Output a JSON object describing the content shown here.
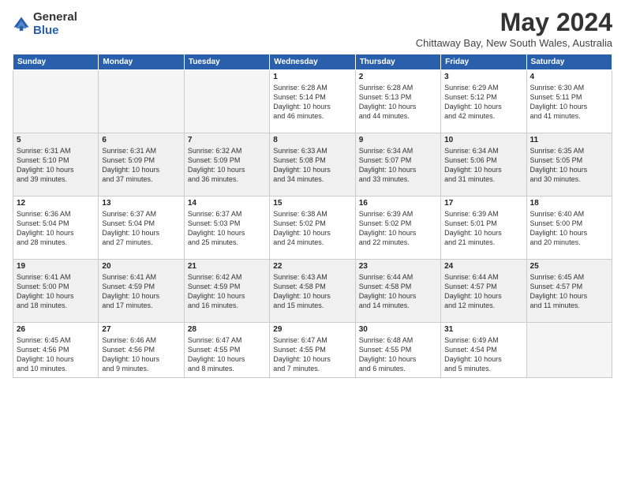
{
  "header": {
    "logo_general": "General",
    "logo_blue": "Blue",
    "title": "May 2024",
    "subtitle": "Chittaway Bay, New South Wales, Australia"
  },
  "weekdays": [
    "Sunday",
    "Monday",
    "Tuesday",
    "Wednesday",
    "Thursday",
    "Friday",
    "Saturday"
  ],
  "weeks": [
    {
      "shaded": false,
      "days": [
        {
          "num": "",
          "info": ""
        },
        {
          "num": "",
          "info": ""
        },
        {
          "num": "",
          "info": ""
        },
        {
          "num": "1",
          "info": "Sunrise: 6:28 AM\nSunset: 5:14 PM\nDaylight: 10 hours\nand 46 minutes."
        },
        {
          "num": "2",
          "info": "Sunrise: 6:28 AM\nSunset: 5:13 PM\nDaylight: 10 hours\nand 44 minutes."
        },
        {
          "num": "3",
          "info": "Sunrise: 6:29 AM\nSunset: 5:12 PM\nDaylight: 10 hours\nand 42 minutes."
        },
        {
          "num": "4",
          "info": "Sunrise: 6:30 AM\nSunset: 5:11 PM\nDaylight: 10 hours\nand 41 minutes."
        }
      ]
    },
    {
      "shaded": true,
      "days": [
        {
          "num": "5",
          "info": "Sunrise: 6:31 AM\nSunset: 5:10 PM\nDaylight: 10 hours\nand 39 minutes."
        },
        {
          "num": "6",
          "info": "Sunrise: 6:31 AM\nSunset: 5:09 PM\nDaylight: 10 hours\nand 37 minutes."
        },
        {
          "num": "7",
          "info": "Sunrise: 6:32 AM\nSunset: 5:09 PM\nDaylight: 10 hours\nand 36 minutes."
        },
        {
          "num": "8",
          "info": "Sunrise: 6:33 AM\nSunset: 5:08 PM\nDaylight: 10 hours\nand 34 minutes."
        },
        {
          "num": "9",
          "info": "Sunrise: 6:34 AM\nSunset: 5:07 PM\nDaylight: 10 hours\nand 33 minutes."
        },
        {
          "num": "10",
          "info": "Sunrise: 6:34 AM\nSunset: 5:06 PM\nDaylight: 10 hours\nand 31 minutes."
        },
        {
          "num": "11",
          "info": "Sunrise: 6:35 AM\nSunset: 5:05 PM\nDaylight: 10 hours\nand 30 minutes."
        }
      ]
    },
    {
      "shaded": false,
      "days": [
        {
          "num": "12",
          "info": "Sunrise: 6:36 AM\nSunset: 5:04 PM\nDaylight: 10 hours\nand 28 minutes."
        },
        {
          "num": "13",
          "info": "Sunrise: 6:37 AM\nSunset: 5:04 PM\nDaylight: 10 hours\nand 27 minutes."
        },
        {
          "num": "14",
          "info": "Sunrise: 6:37 AM\nSunset: 5:03 PM\nDaylight: 10 hours\nand 25 minutes."
        },
        {
          "num": "15",
          "info": "Sunrise: 6:38 AM\nSunset: 5:02 PM\nDaylight: 10 hours\nand 24 minutes."
        },
        {
          "num": "16",
          "info": "Sunrise: 6:39 AM\nSunset: 5:02 PM\nDaylight: 10 hours\nand 22 minutes."
        },
        {
          "num": "17",
          "info": "Sunrise: 6:39 AM\nSunset: 5:01 PM\nDaylight: 10 hours\nand 21 minutes."
        },
        {
          "num": "18",
          "info": "Sunrise: 6:40 AM\nSunset: 5:00 PM\nDaylight: 10 hours\nand 20 minutes."
        }
      ]
    },
    {
      "shaded": true,
      "days": [
        {
          "num": "19",
          "info": "Sunrise: 6:41 AM\nSunset: 5:00 PM\nDaylight: 10 hours\nand 18 minutes."
        },
        {
          "num": "20",
          "info": "Sunrise: 6:41 AM\nSunset: 4:59 PM\nDaylight: 10 hours\nand 17 minutes."
        },
        {
          "num": "21",
          "info": "Sunrise: 6:42 AM\nSunset: 4:59 PM\nDaylight: 10 hours\nand 16 minutes."
        },
        {
          "num": "22",
          "info": "Sunrise: 6:43 AM\nSunset: 4:58 PM\nDaylight: 10 hours\nand 15 minutes."
        },
        {
          "num": "23",
          "info": "Sunrise: 6:44 AM\nSunset: 4:58 PM\nDaylight: 10 hours\nand 14 minutes."
        },
        {
          "num": "24",
          "info": "Sunrise: 6:44 AM\nSunset: 4:57 PM\nDaylight: 10 hours\nand 12 minutes."
        },
        {
          "num": "25",
          "info": "Sunrise: 6:45 AM\nSunset: 4:57 PM\nDaylight: 10 hours\nand 11 minutes."
        }
      ]
    },
    {
      "shaded": false,
      "days": [
        {
          "num": "26",
          "info": "Sunrise: 6:45 AM\nSunset: 4:56 PM\nDaylight: 10 hours\nand 10 minutes."
        },
        {
          "num": "27",
          "info": "Sunrise: 6:46 AM\nSunset: 4:56 PM\nDaylight: 10 hours\nand 9 minutes."
        },
        {
          "num": "28",
          "info": "Sunrise: 6:47 AM\nSunset: 4:55 PM\nDaylight: 10 hours\nand 8 minutes."
        },
        {
          "num": "29",
          "info": "Sunrise: 6:47 AM\nSunset: 4:55 PM\nDaylight: 10 hours\nand 7 minutes."
        },
        {
          "num": "30",
          "info": "Sunrise: 6:48 AM\nSunset: 4:55 PM\nDaylight: 10 hours\nand 6 minutes."
        },
        {
          "num": "31",
          "info": "Sunrise: 6:49 AM\nSunset: 4:54 PM\nDaylight: 10 hours\nand 5 minutes."
        },
        {
          "num": "",
          "info": ""
        }
      ]
    }
  ]
}
